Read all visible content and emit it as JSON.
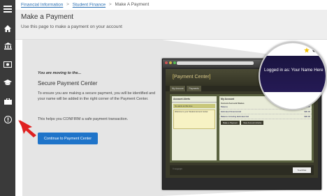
{
  "breadcrumb": {
    "items": [
      "Financial Information",
      "Student Finance",
      "Make A Payment"
    ],
    "separator": ">"
  },
  "header": {
    "title": "Make a Payment",
    "subtitle": "Use this page to make a payment on your account"
  },
  "content": {
    "moving_label": "You are moving to the...",
    "secure_title": "Secure Payment Center",
    "body": "To ensure you are making a secure payment, you will be identified and your name will be added in the right corner of the Payment Center.",
    "body2": "This helps you CONFIRM a safe payment transaction.",
    "cta_label": "Continue to Payment Center"
  },
  "mock": {
    "banner_open": "[",
    "banner_text": "Payment Center",
    "banner_close": "]",
    "tabs": [
      "My Account",
      "Payments"
    ],
    "left_header": "Account Alerts",
    "left_tile": "No alerts at this time",
    "left_note_title": "Welcome to your Student Account Center.",
    "right_header": "My Account",
    "right_sub": "Current Account Status",
    "rows": [
      {
        "label": "Balance",
        "value": "$00.00"
      },
      {
        "label": "Estimated Financial Aid",
        "value": "$00.00"
      },
      {
        "label": "Balance Including Estimated Aid",
        "value": "$00.00"
      }
    ],
    "buttons": [
      "Make a Payment",
      "View Account Activity"
    ],
    "footer_copy": "© Copyright",
    "logo_text": "TouchNet"
  },
  "magnifier": {
    "text": "Logged in as: Your Name Here"
  },
  "colors": {
    "accent": "#1f74c9",
    "rail": "#3a3a3a",
    "arrow": "#e02020"
  },
  "icons": {
    "rail": [
      "menu-icon",
      "home-icon",
      "bank-icon",
      "money-icon",
      "graduation-cap-icon",
      "briefcase-icon",
      "alert-icon"
    ]
  }
}
